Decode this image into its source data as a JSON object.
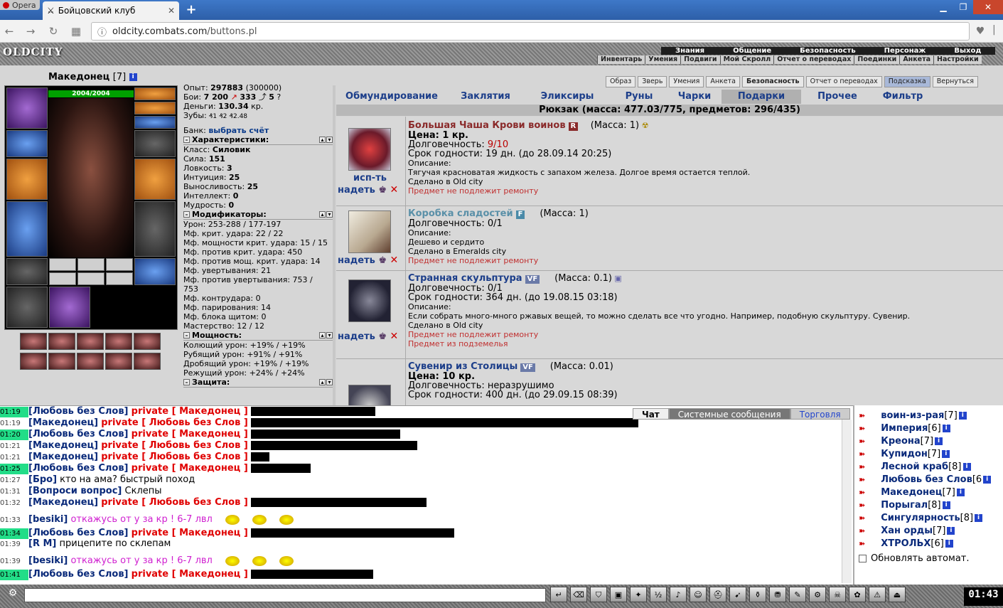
{
  "browser": {
    "opera_label": "Opera",
    "tab_title": "Бойцовский клуб",
    "url_domain": "oldcity.combats.com",
    "url_path": "/buttons.pl"
  },
  "header": {
    "logo": "OLDCITY",
    "menu_top": [
      "Знания",
      "Общение",
      "Безопасность",
      "Персонаж",
      "Выход"
    ],
    "menu_bottom": [
      "Инвентарь",
      "Умения",
      "Подвиги",
      "Мой Скролл",
      "Отчет о переводах",
      "Поединки",
      "Анкета",
      "Настройки"
    ]
  },
  "player": {
    "name": "Македонец",
    "level": "[7]",
    "hp": "2004/2004",
    "stats": {
      "exp_label": "Опыт:",
      "exp": "297883",
      "exp_next": "(300000)",
      "fights_label": "Бои:",
      "fights": "7 200",
      "fights2": "333",
      "fights3": "5",
      "money_label": "Деньги:",
      "money": "130.34",
      "money_unit": "кр.",
      "teeth_label": "Зубы:",
      "teeth": "₰1 ₰2 ₰2.48",
      "bank_label": "Банк:",
      "bank_link": "выбрать счёт"
    },
    "char_title": "Характеристики:",
    "char_lines": [
      {
        "k": "Класс:",
        "v": "Силовик"
      },
      {
        "k": "Сила:",
        "v": "151"
      },
      {
        "k": "Ловкость:",
        "v": "3"
      },
      {
        "k": "Интуиция:",
        "v": "25"
      },
      {
        "k": "Выносливость:",
        "v": "25"
      },
      {
        "k": "Интеллект:",
        "v": "0"
      },
      {
        "k": "Мудрость:",
        "v": "0"
      }
    ],
    "mod_title": "Модификаторы:",
    "mod_lines": [
      "Урон: 253-288 / 177-197",
      "Мф. крит. удара: 22 / 22",
      "Мф. мощности крит. удара: 15 / 15",
      "Мф. против крит. удара: 450",
      "Мф. против мощ. крит. удара: 14",
      "Мф. увертывания: 21",
      "Мф. против увертывания: 753 /",
      "753",
      "Мф. контрудара: 0",
      "Мф. парирования: 14",
      "Мф. блока щитом: 0",
      "Мастерство: 12 / 12"
    ],
    "power_title": "Мощность:",
    "power_lines": [
      "Колющий урон: +19% / +19%",
      "Рубящий урон: +91% / +91%",
      "Дробящий урон: +19% / +19%",
      "Режущий урон: +24% / +24%"
    ],
    "defense_title": "Защита:"
  },
  "top_buttons": [
    "Образ",
    "Зверь",
    "Умения",
    "Анкета",
    "Безопасность",
    "Отчет о переводах",
    "Подсказка",
    "Вернуться"
  ],
  "categories": [
    "Обмундирование",
    "Заклятия",
    "Эликсиры",
    "Руны",
    "Чарки",
    "Подарки",
    "Прочее",
    "Фильтр"
  ],
  "backpack": "Рюкзак (масса: 477.03/775, предметов: 296/435)",
  "items": [
    {
      "name": "Большая Чаша Крови воинов",
      "badge": "R",
      "mass": "(Масса: 1)",
      "price": "Цена: 1 кр.",
      "dur_label": "Долговечность:",
      "dur": "9/10",
      "expiry": "Срок годности: 19 дн. (до 28.09.14 20:25)",
      "desc_label": "Описание:",
      "desc": "Тягучая красноватая жидкость с запахом железа. Долгое время остается теплой.",
      "made": "Сделано в Old city",
      "note1": "Предмет не подлежит ремонту",
      "act1": "исп-ть",
      "act2": "надеть"
    },
    {
      "name": "Коробка сладостей",
      "badge": "F",
      "mass": "(Масса: 1)",
      "dur": "Долговечность: 0/1",
      "desc_label": "Описание:",
      "desc": "Дешево и сердито",
      "made": "Сделано в Emeralds city",
      "note1": "Предмет не подлежит ремонту",
      "act2": "надеть"
    },
    {
      "name": "Странная скульптура",
      "badge": "VF",
      "mass": "(Масса: 0.1)",
      "dur": "Долговечность: 0/1",
      "expiry": "Срок годности: 364 дн. (до 19.08.15 03:18)",
      "desc_label": "Описание:",
      "desc": "Если собрать много-много ржавых вещей, то можно сделать все что угодно. Например, подобную скульптуру. Сувенир.",
      "made": "Сделано в Old city",
      "note1": "Предмет не подлежит ремонту",
      "note2": "Предмет из подземелья",
      "act2": "надеть"
    },
    {
      "name": "Сувенир из Столицы",
      "badge": "VF",
      "mass": "(Масса: 0.01)",
      "price": "Цена: 10 кр.",
      "dur": "Долговечность: неразрушимо",
      "expiry": "Срок годности: 400 дн. (до 29.09.15 08:39)"
    }
  ],
  "chat_tabs": [
    "Чат",
    "Системные сообщения",
    "Торговля"
  ],
  "chat": [
    {
      "t": "01:19",
      "g": true,
      "n": "[Любовь без Слов]",
      "p": "private [ Македонец ]",
      "m": "",
      "w": 175
    },
    {
      "t": "01:19",
      "g": false,
      "n": "[Македонец]",
      "p": "private [ Любовь без Слов ]",
      "m": "",
      "w": 545
    },
    {
      "t": "01:20",
      "g": true,
      "n": "[Любовь без Слов]",
      "p": "private [ Македонец ]",
      "m": "",
      "w": 210
    },
    {
      "t": "01:21",
      "g": false,
      "n": "[Македонец]",
      "p": "private [ Любовь без Слов ]",
      "m": "",
      "w": 234
    },
    {
      "t": "01:21",
      "g": false,
      "n": "[Македонец]",
      "p": "private [ Любовь без Слов ]",
      "m": "",
      "w": 26
    },
    {
      "t": "01:25",
      "g": true,
      "n": "[Любовь без Слов]",
      "p": "private [ Македонец ]",
      "m": "",
      "w": 84
    },
    {
      "t": "01:27",
      "g": false,
      "n": "[Бро]",
      "p": "",
      "m": "кто на ама? быстрый поход",
      "w": 0
    },
    {
      "t": "01:31",
      "g": false,
      "n": "[Вопроси вопрос]",
      "p": "",
      "m": "Склепы",
      "w": 0
    },
    {
      "t": "01:32",
      "g": false,
      "n": "[Македонец]",
      "p": "private [ Любовь без Слов ]",
      "m": "",
      "w": 247
    },
    {
      "t": "01:33",
      "g": false,
      "n": "[besiki]",
      "p": "",
      "m": "откажусь от у за кр ! 6-7 лвл",
      "w": 0,
      "pink": true
    },
    {
      "t": "01:34",
      "g": true,
      "n": "[Любовь без Слов]",
      "p": "private [ Македонец ]",
      "m": "",
      "w": 286
    },
    {
      "t": "01:39",
      "g": false,
      "n": "[R M]",
      "p": "",
      "m": "прицепите по склепам",
      "w": 0
    },
    {
      "t": "01:39",
      "g": false,
      "n": "[besiki]",
      "p": "",
      "m": "откажусь от у за кр ! 6-7 лвл",
      "w": 0,
      "pink": true
    },
    {
      "t": "01:41",
      "g": true,
      "n": "[Любовь без Слов]",
      "p": "private [ Македонец ]",
      "m": "",
      "w": 172
    }
  ],
  "users": [
    {
      "n": "воин-из-рая",
      "l": "[7]"
    },
    {
      "n": "Империя",
      "l": "[6]"
    },
    {
      "n": "Креона",
      "l": "[7]"
    },
    {
      "n": "Купидон",
      "l": "[7]"
    },
    {
      "n": "Лесной краб",
      "l": "[8]"
    },
    {
      "n": "Любовь без Слов",
      "l": "[6"
    },
    {
      "n": "Македонец",
      "l": "[7]"
    },
    {
      "n": "Порыгал",
      "l": "[8]"
    },
    {
      "n": "Сингулярность",
      "l": "[8]"
    },
    {
      "n": "Хан орды",
      "l": "[7]"
    },
    {
      "n": "ХТРОЛЬХ",
      "l": "[6]"
    }
  ],
  "auto_update": "Обновлять автомат.",
  "clock": "01:43",
  "colors": {
    "accent": "#1c3e8a",
    "private": "#e00000",
    "timestamp_highlight": "#22dd88"
  }
}
